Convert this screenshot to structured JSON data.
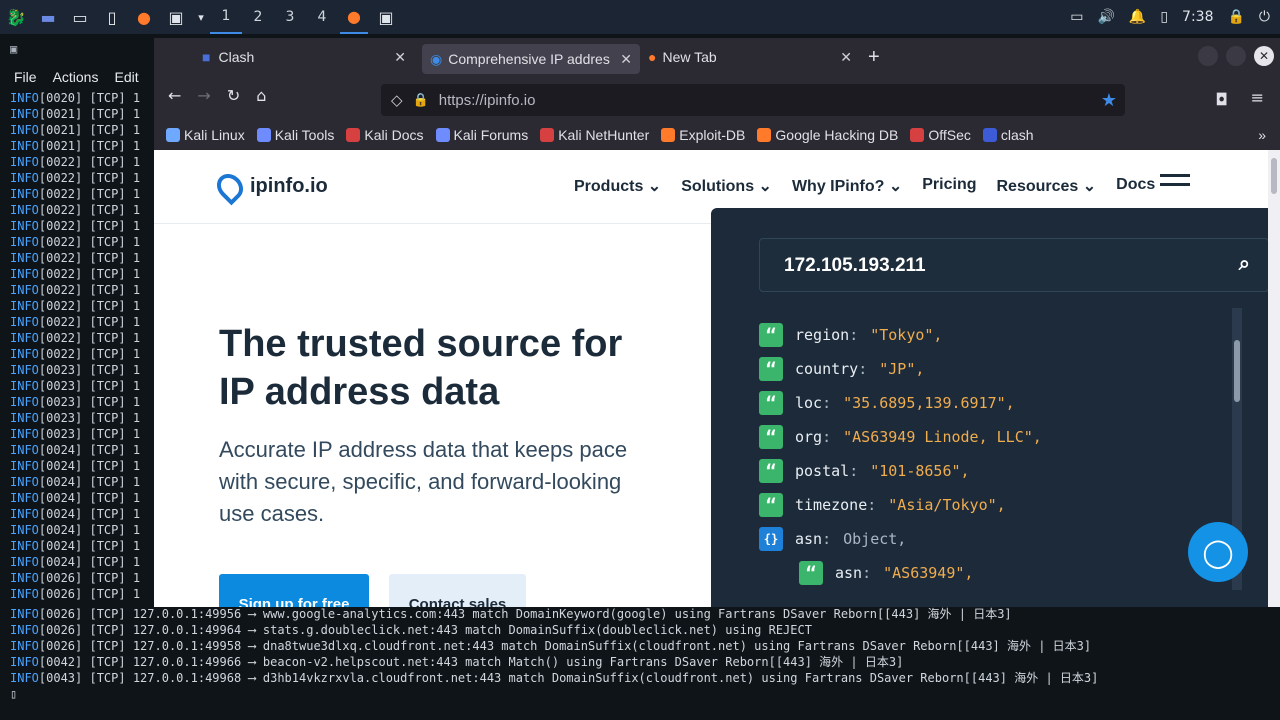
{
  "taskbar": {
    "workspaces": [
      "1",
      "2",
      "3",
      "4"
    ],
    "time": "7:38"
  },
  "terminal": {
    "menu": [
      "File",
      "Actions",
      "Edit"
    ],
    "left_lines": [
      "[0020] [TCP] 1",
      "[0021] [TCP] 1",
      "[0021] [TCP] 1",
      "[0021] [TCP] 1",
      "[0022] [TCP] 1",
      "[0022] [TCP] 1",
      "[0022] [TCP] 1",
      "[0022] [TCP] 1",
      "[0022] [TCP] 1",
      "[0022] [TCP] 1",
      "[0022] [TCP] 1",
      "[0022] [TCP] 1",
      "[0022] [TCP] 1",
      "[0022] [TCP] 1",
      "[0022] [TCP] 1",
      "[0022] [TCP] 1",
      "[0022] [TCP] 1",
      "[0023] [TCP] 1",
      "[0023] [TCP] 1",
      "[0023] [TCP] 1",
      "[0023] [TCP] 1",
      "[0023] [TCP] 1",
      "[0024] [TCP] 1",
      "[0024] [TCP] 1",
      "[0024] [TCP] 1",
      "[0024] [TCP] 1",
      "[0024] [TCP] 1",
      "[0024] [TCP] 1",
      "[0024] [TCP] 1",
      "[0024] [TCP] 1",
      "[0026] [TCP] 1",
      "[0026] [TCP] 1"
    ],
    "bottom_lines": [
      "[0026] [TCP] 127.0.0.1:49956 ⟶ www.google-analytics.com:443 match DomainKeyword(google) using Fartrans DSaver Reborn[[443] 海外 | 日本3]",
      "[0026] [TCP] 127.0.0.1:49964 ⟶ stats.g.doubleclick.net:443 match DomainSuffix(doubleclick.net) using REJECT",
      "[0026] [TCP] 127.0.0.1:49958 ⟶ dna8twue3dlxq.cloudfront.net:443 match DomainSuffix(cloudfront.net) using Fartrans DSaver Reborn[[443] 海外 | 日本3]",
      "[0042] [TCP] 127.0.0.1:49966 ⟶ beacon-v2.helpscout.net:443 match Match() using Fartrans DSaver Reborn[[443] 海外 | 日本3]",
      "[0043] [TCP] 127.0.0.1:49968 ⟶ d3hb14vkzrxvla.cloudfront.net:443 match DomainSuffix(cloudfront.net) using Fartrans DSaver Reborn[[443] 海外 | 日本3]"
    ],
    "info_prefix": "INFO"
  },
  "browser": {
    "tabs": [
      {
        "title": "Clash"
      },
      {
        "title": "Comprehensive IP addres"
      },
      {
        "title": "New Tab"
      }
    ],
    "url": "https://ipinfo.io",
    "bookmarks": [
      "Kali Linux",
      "Kali Tools",
      "Kali Docs",
      "Kali Forums",
      "Kali NetHunter",
      "Exploit-DB",
      "Google Hacking DB",
      "OffSec",
      "clash"
    ]
  },
  "page": {
    "logo": "ipinfo.io",
    "nav": [
      "Products",
      "Solutions",
      "Why IPinfo?",
      "Pricing",
      "Resources",
      "Docs"
    ],
    "hero_title": "The trusted source for IP address data",
    "hero_sub": "Accurate IP address data that keeps pace with secure, specific, and forward-looking use cases.",
    "btn_signup": "Sign up for free",
    "btn_contact": "Contact sales",
    "ip": "172.105.193.211",
    "json": [
      {
        "key": "region",
        "value": "\"Tokyo\","
      },
      {
        "key": "country",
        "value": "\"JP\","
      },
      {
        "key": "loc",
        "value": "\"35.6895,139.6917\","
      },
      {
        "key": "org",
        "value": "\"AS63949 Linode, LLC\","
      },
      {
        "key": "postal",
        "value": "\"101-8656\","
      },
      {
        "key": "timezone",
        "value": "\"Asia/Tokyo\","
      }
    ],
    "asn_key": "asn",
    "asn_obj": "Object,",
    "asn_sub_key": "asn",
    "asn_sub_value": "\"AS63949\","
  }
}
